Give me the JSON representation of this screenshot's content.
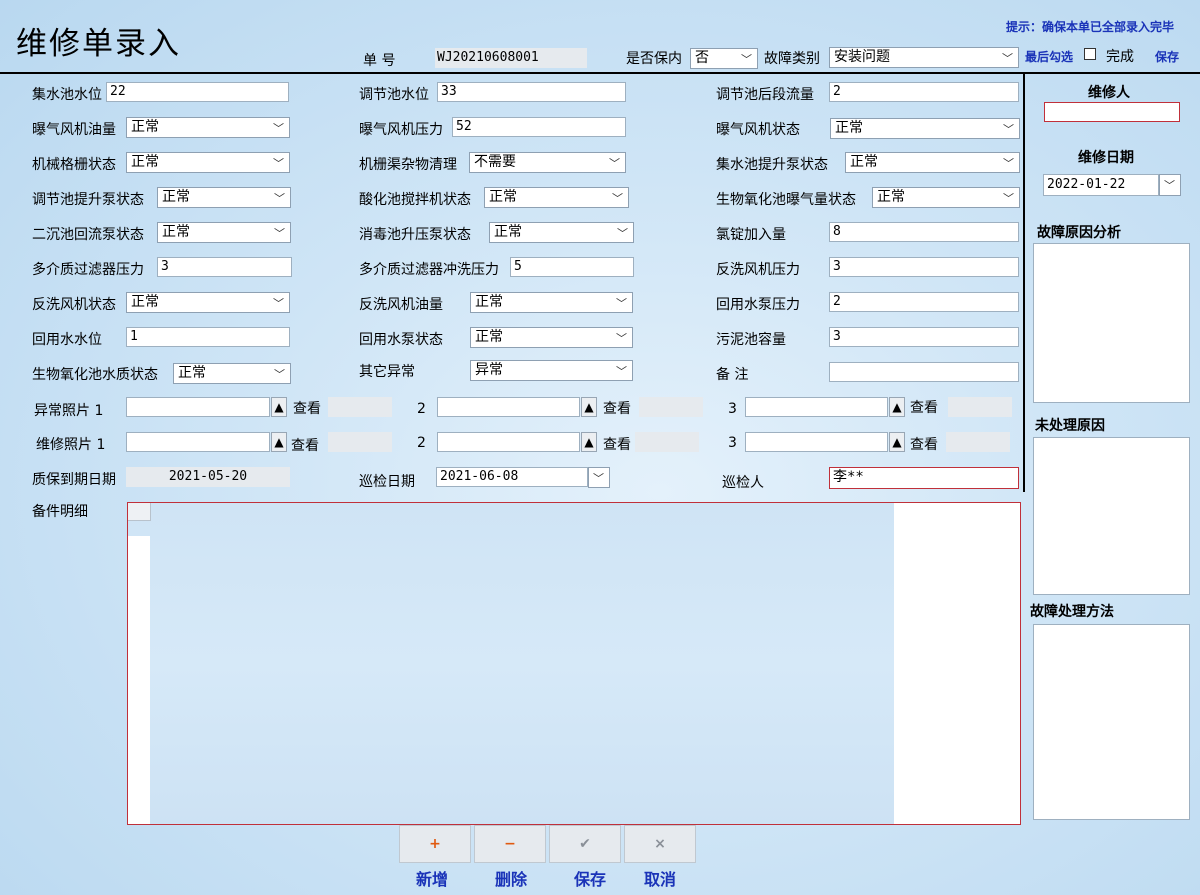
{
  "header": {
    "title": "维修单录入",
    "hint": "提示：确保本单已全部录入完毕",
    "order_no_label": "单 号",
    "order_no": "WJ20210608001",
    "warranty_label": "是否保内",
    "warranty_value": "否",
    "fault_type_label": "故障类别",
    "fault_type_value": "安装问题",
    "last_check_label": "最后勾选",
    "complete_label": "完成",
    "save_link": "保存"
  },
  "fields": {
    "r1": {
      "a_label": "集水池水位",
      "a_value": "22",
      "b_label": "调节池水位",
      "b_value": "33",
      "c_label": "调节池后段流量",
      "c_value": "2"
    },
    "r2": {
      "a_label": "曝气风机油量",
      "a_value": "正常",
      "b_label": "曝气风机压力",
      "b_value": "52",
      "c_label": "曝气风机状态",
      "c_value": "正常"
    },
    "r3": {
      "a_label": "机械格栅状态",
      "a_value": "正常",
      "b_label": "机栅渠杂物清理",
      "b_value": "不需要",
      "c_label": "集水池提升泵状态",
      "c_value": "正常"
    },
    "r4": {
      "a_label": "调节池提升泵状态",
      "a_value": "正常",
      "b_label": "酸化池搅拌机状态",
      "b_value": "正常",
      "c_label": "生物氧化池曝气量状态",
      "c_value": "正常"
    },
    "r5": {
      "a_label": "二沉池回流泵状态",
      "a_value": "正常",
      "b_label": "消毒池升压泵状态",
      "b_value": "正常",
      "c_label": "氯锭加入量",
      "c_value": "8"
    },
    "r6": {
      "a_label": "多介质过滤器压力",
      "a_value": "3",
      "b_label": "多介质过滤器冲洗压力",
      "b_value": "5",
      "c_label": "反洗风机压力",
      "c_value": "3"
    },
    "r7": {
      "a_label": "反洗风机状态",
      "a_value": "正常",
      "b_label": "反洗风机油量",
      "b_value": "正常",
      "c_label": "回用水泵压力",
      "c_value": "2"
    },
    "r8": {
      "a_label": "回用水水位",
      "a_value": "1",
      "b_label": "回用水泵状态",
      "b_value": "正常",
      "c_label": "污泥池容量",
      "c_value": "3"
    },
    "r9": {
      "a_label": "生物氧化池水质状态",
      "a_value": "正常",
      "b_label": "其它异常",
      "b_value": "异常",
      "c_label": "备 注",
      "c_value": ""
    }
  },
  "photos": {
    "abnormal_label": "异常照片",
    "repair_label": "维修照片",
    "n1": "1",
    "n2": "2",
    "n3": "3",
    "view": "查看",
    "up_icon": "▲"
  },
  "dates": {
    "warranty_expiry_label": "质保到期日期",
    "warranty_expiry": "2021-05-20",
    "inspect_date_label": "巡检日期",
    "inspect_date": "2021-06-08",
    "inspector_label": "巡检人",
    "inspector": "李**"
  },
  "parts": {
    "label": "备件明细"
  },
  "side": {
    "repairer_label": "维修人",
    "repairer": "",
    "repair_date_label": "维修日期",
    "repair_date": "2022-01-22",
    "cause_label": "故障原因分析",
    "unhandled_label": "未处理原因",
    "method_label": "故障处理方法"
  },
  "buttons": {
    "add": {
      "icon": "+",
      "label": "新增",
      "color": "#e05a10"
    },
    "delete": {
      "icon": "−",
      "label": "删除",
      "color": "#e05a10"
    },
    "save": {
      "icon": "✔",
      "label": "保存",
      "color": "#8a9098"
    },
    "cancel": {
      "icon": "×",
      "label": "取消",
      "color": "#8a9098"
    }
  },
  "colors": {
    "accent": "#1a33b8",
    "required_border": "#c0303a"
  }
}
